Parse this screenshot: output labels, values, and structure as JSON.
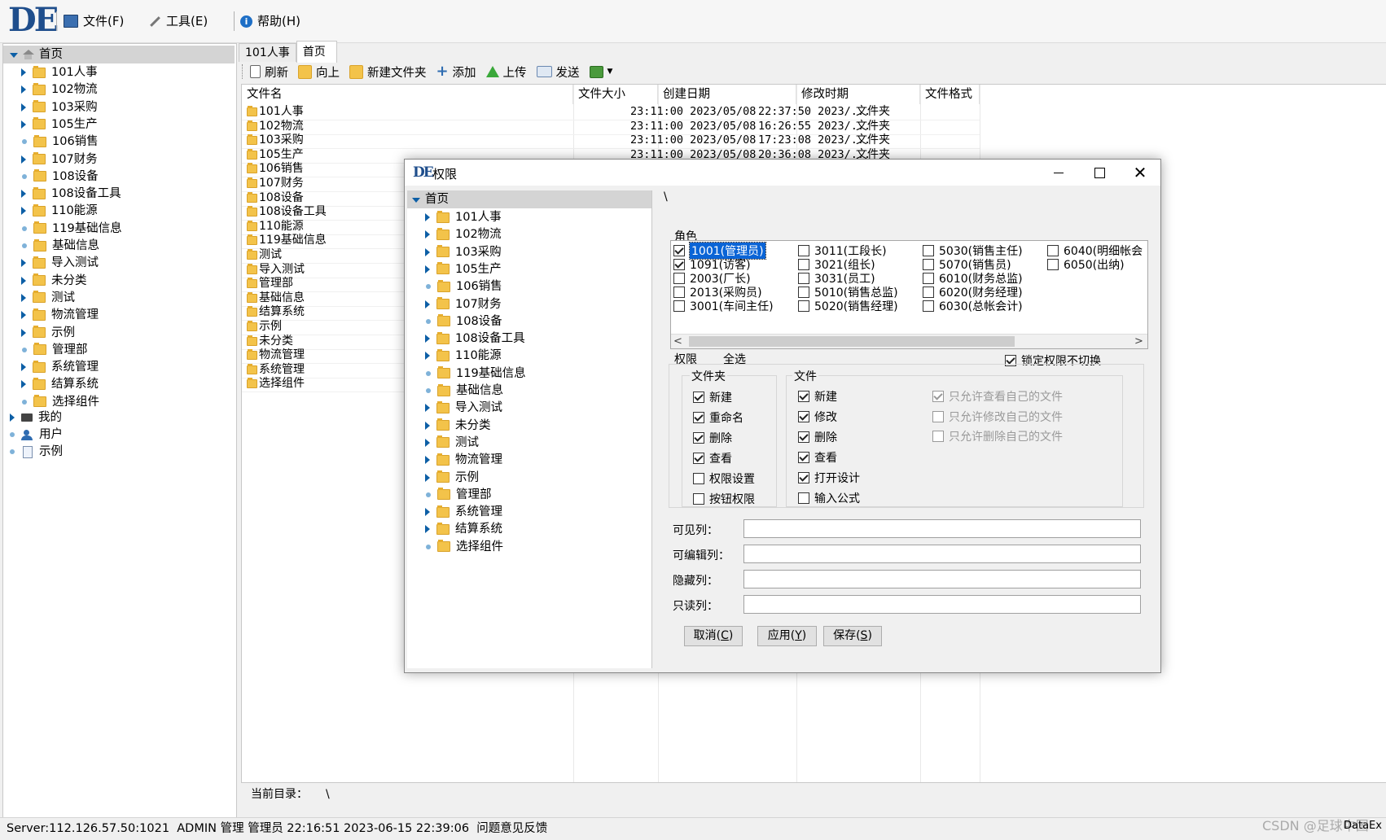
{
  "menu": {
    "logo_text": "DE",
    "file": "文件(F)",
    "tools": "工具(E)",
    "help": "帮助(H)"
  },
  "left_tree": {
    "root": "首页",
    "children": [
      {
        "label": "101人事",
        "expander": "arrow"
      },
      {
        "label": "102物流",
        "expander": "arrow"
      },
      {
        "label": "103采购",
        "expander": "arrow"
      },
      {
        "label": "105生产",
        "expander": "arrow"
      },
      {
        "label": "106销售",
        "expander": "dot"
      },
      {
        "label": "107财务",
        "expander": "arrow"
      },
      {
        "label": "108设备",
        "expander": "dot"
      },
      {
        "label": "108设备工具",
        "expander": "arrow"
      },
      {
        "label": "110能源",
        "expander": "arrow"
      },
      {
        "label": "119基础信息",
        "expander": "dot"
      },
      {
        "label": "基础信息",
        "expander": "dot"
      },
      {
        "label": "导入测试",
        "expander": "arrow"
      },
      {
        "label": "未分类",
        "expander": "arrow"
      },
      {
        "label": "测试",
        "expander": "arrow"
      },
      {
        "label": "物流管理",
        "expander": "arrow"
      },
      {
        "label": "示例",
        "expander": "arrow"
      },
      {
        "label": "管理部",
        "expander": "dot"
      },
      {
        "label": "系统管理",
        "expander": "arrow"
      },
      {
        "label": "结算系统",
        "expander": "arrow"
      },
      {
        "label": "选择组件",
        "expander": "dot"
      }
    ],
    "mine": "我的",
    "users": "用户",
    "examples": "示例"
  },
  "tabs": [
    "101人事",
    "首页"
  ],
  "toolbar": {
    "refresh": "刷新",
    "up": "向上",
    "new_folder": "新建文件夹",
    "add": "添加",
    "upload": "上传",
    "send": "发送"
  },
  "grid": {
    "headers": [
      "文件名",
      "文件大小",
      "创建日期",
      "修改时期",
      "文件格式"
    ],
    "rows": [
      {
        "name": "101人事",
        "size": "",
        "created": "23:11:00 2023/05/08",
        "modified": "22:37:50 2023/...",
        "format": "文件夹"
      },
      {
        "name": "102物流",
        "size": "",
        "created": "23:11:00 2023/05/08",
        "modified": "16:26:55 2023/...",
        "format": "文件夹"
      },
      {
        "name": "103采购",
        "size": "",
        "created": "23:11:00 2023/05/08",
        "modified": "17:23:08 2023/...",
        "format": "文件夹"
      },
      {
        "name": "105生产",
        "size": "",
        "created": "23:11:00 2023/05/08",
        "modified": "20:36:08 2023/...",
        "format": "文件夹"
      },
      {
        "name": "106销售",
        "size": "",
        "created": "",
        "modified": "",
        "format": ""
      },
      {
        "name": "107财务",
        "size": "",
        "created": "",
        "modified": "",
        "format": ""
      },
      {
        "name": "108设备",
        "size": "",
        "created": "",
        "modified": "",
        "format": ""
      },
      {
        "name": "108设备工具",
        "size": "",
        "created": "",
        "modified": "",
        "format": ""
      },
      {
        "name": "110能源",
        "size": "",
        "created": "",
        "modified": "",
        "format": ""
      },
      {
        "name": "119基础信息",
        "size": "",
        "created": "",
        "modified": "",
        "format": ""
      },
      {
        "name": "测试",
        "size": "",
        "created": "",
        "modified": "",
        "format": ""
      },
      {
        "name": "导入测试",
        "size": "",
        "created": "",
        "modified": "",
        "format": ""
      },
      {
        "name": "管理部",
        "size": "",
        "created": "",
        "modified": "",
        "format": ""
      },
      {
        "name": "基础信息",
        "size": "",
        "created": "",
        "modified": "",
        "format": ""
      },
      {
        "name": "结算系统",
        "size": "",
        "created": "",
        "modified": "",
        "format": ""
      },
      {
        "name": "示例",
        "size": "",
        "created": "",
        "modified": "",
        "format": ""
      },
      {
        "name": "未分类",
        "size": "",
        "created": "",
        "modified": "",
        "format": ""
      },
      {
        "name": "物流管理",
        "size": "",
        "created": "",
        "modified": "",
        "format": ""
      },
      {
        "name": "系统管理",
        "size": "",
        "created": "",
        "modified": "",
        "format": ""
      },
      {
        "name": "选择组件",
        "size": "",
        "created": "",
        "modified": "",
        "format": ""
      }
    ]
  },
  "current_dir": {
    "label": "当前目录：",
    "value": "\\"
  },
  "status": "Server:112.126.57.50:1021  ADMIN 管理 管理员 22:16:51 2023-06-15 22:39:06  问题意见反馈",
  "watermark": "CSDN @足球中国",
  "edge_text": "DataEx",
  "dialog": {
    "title": "权限",
    "icon_text": "DE",
    "path": "\\",
    "tree_root": "首页",
    "role_label": "角色",
    "roles": [
      {
        "label": "1001(管理员)",
        "checked": true,
        "selected": true
      },
      {
        "label": "1091(访客)",
        "checked": true
      },
      {
        "label": "2003(厂长)",
        "checked": false
      },
      {
        "label": "2013(采购员)",
        "checked": false
      },
      {
        "label": "3001(车间主任)",
        "checked": false
      },
      {
        "label": "3011(工段长)",
        "checked": false
      },
      {
        "label": "3021(组长)",
        "checked": false
      },
      {
        "label": "3031(员工)",
        "checked": false
      },
      {
        "label": "5010(销售总监)",
        "checked": false
      },
      {
        "label": "5020(销售经理)",
        "checked": false
      },
      {
        "label": "5030(销售主任)",
        "checked": false
      },
      {
        "label": "5070(销售员)",
        "checked": false
      },
      {
        "label": "6010(财务总监)",
        "checked": false
      },
      {
        "label": "6020(财务经理)",
        "checked": false
      },
      {
        "label": "6030(总帐会计)",
        "checked": false
      },
      {
        "label": "6040(明细帐会",
        "checked": false
      },
      {
        "label": "6050(出纳)",
        "checked": false
      }
    ],
    "perm_label": "权限",
    "select_all": "全选",
    "lock_label": "锁定权限不切换",
    "lock_checked": true,
    "folder_group": "文件夹",
    "folder_perms": [
      {
        "label": "新建",
        "checked": true
      },
      {
        "label": "重命名",
        "checked": true
      },
      {
        "label": "删除",
        "checked": true
      },
      {
        "label": "查看",
        "checked": true
      },
      {
        "label": "权限设置",
        "checked": false
      },
      {
        "label": "按钮权限",
        "checked": false
      }
    ],
    "file_group": "文件",
    "file_perms": [
      {
        "label": "新建",
        "checked": true
      },
      {
        "label": "修改",
        "checked": true
      },
      {
        "label": "删除",
        "checked": true
      },
      {
        "label": "查看",
        "checked": true
      },
      {
        "label": "打开设计",
        "checked": true
      },
      {
        "label": "输入公式",
        "checked": false
      }
    ],
    "own_perms": [
      {
        "label": "只允许查看自己的文件",
        "checked": true
      },
      {
        "label": "只允许修改自己的文件",
        "checked": false
      },
      {
        "label": "只允许删除自己的文件",
        "checked": false
      }
    ],
    "visible_cols": "可见列：",
    "editable_cols": "可编辑列：",
    "hidden_cols": "隐藏列：",
    "readonly_cols": "只读列：",
    "cancel": "取消",
    "cancel_key": "C",
    "apply": "应用",
    "apply_key": "Y",
    "save": "保存",
    "save_key": "S"
  },
  "colors": {
    "accent": "#0d5fa6",
    "selection": "#0a64d6",
    "folder": "#f3c34a"
  }
}
